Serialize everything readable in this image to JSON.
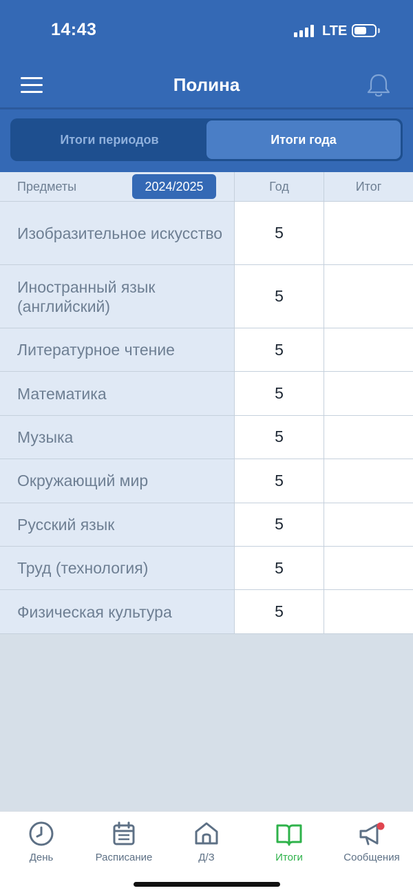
{
  "status_bar": {
    "time": "14:43",
    "network": "LTE",
    "signal_bars": 4,
    "battery_level": 0.6
  },
  "nav": {
    "title": "Полина",
    "menu_icon": "menu-icon",
    "notification_icon": "bell-icon"
  },
  "segments": {
    "periods_label": "Итоги периодов",
    "year_label": "Итоги года",
    "selected": "year"
  },
  "table": {
    "headers": {
      "subjects": "Предметы",
      "year_badge": "2024/2025",
      "year": "Год",
      "final": "Итог"
    },
    "rows": [
      {
        "subject": "Изобразительное искусство",
        "year": "5",
        "final": ""
      },
      {
        "subject": "Иностранный язык (английский)",
        "year": "5",
        "final": ""
      },
      {
        "subject": "Литературное чтение",
        "year": "5",
        "final": ""
      },
      {
        "subject": "Математика",
        "year": "5",
        "final": ""
      },
      {
        "subject": "Музыка",
        "year": "5",
        "final": ""
      },
      {
        "subject": "Окружающий мир",
        "year": "5",
        "final": ""
      },
      {
        "subject": "Русский язык",
        "year": "5",
        "final": ""
      },
      {
        "subject": "Труд (технология)",
        "year": "5",
        "final": ""
      },
      {
        "subject": "Физическая культура",
        "year": "5",
        "final": ""
      }
    ]
  },
  "tabbar": {
    "items": [
      {
        "label": "День",
        "icon": "clock-icon"
      },
      {
        "label": "Расписание",
        "icon": "calendar-icon"
      },
      {
        "label": "Д/З",
        "icon": "home-icon"
      },
      {
        "label": "Итоги",
        "icon": "book-icon"
      },
      {
        "label": "Сообщения",
        "icon": "megaphone-icon"
      }
    ],
    "active_index": 3
  },
  "colors": {
    "header": "#3469b5",
    "accent_active": "#2eb24a",
    "badge": "#3469b5",
    "notification_dot": "#e0454f"
  }
}
